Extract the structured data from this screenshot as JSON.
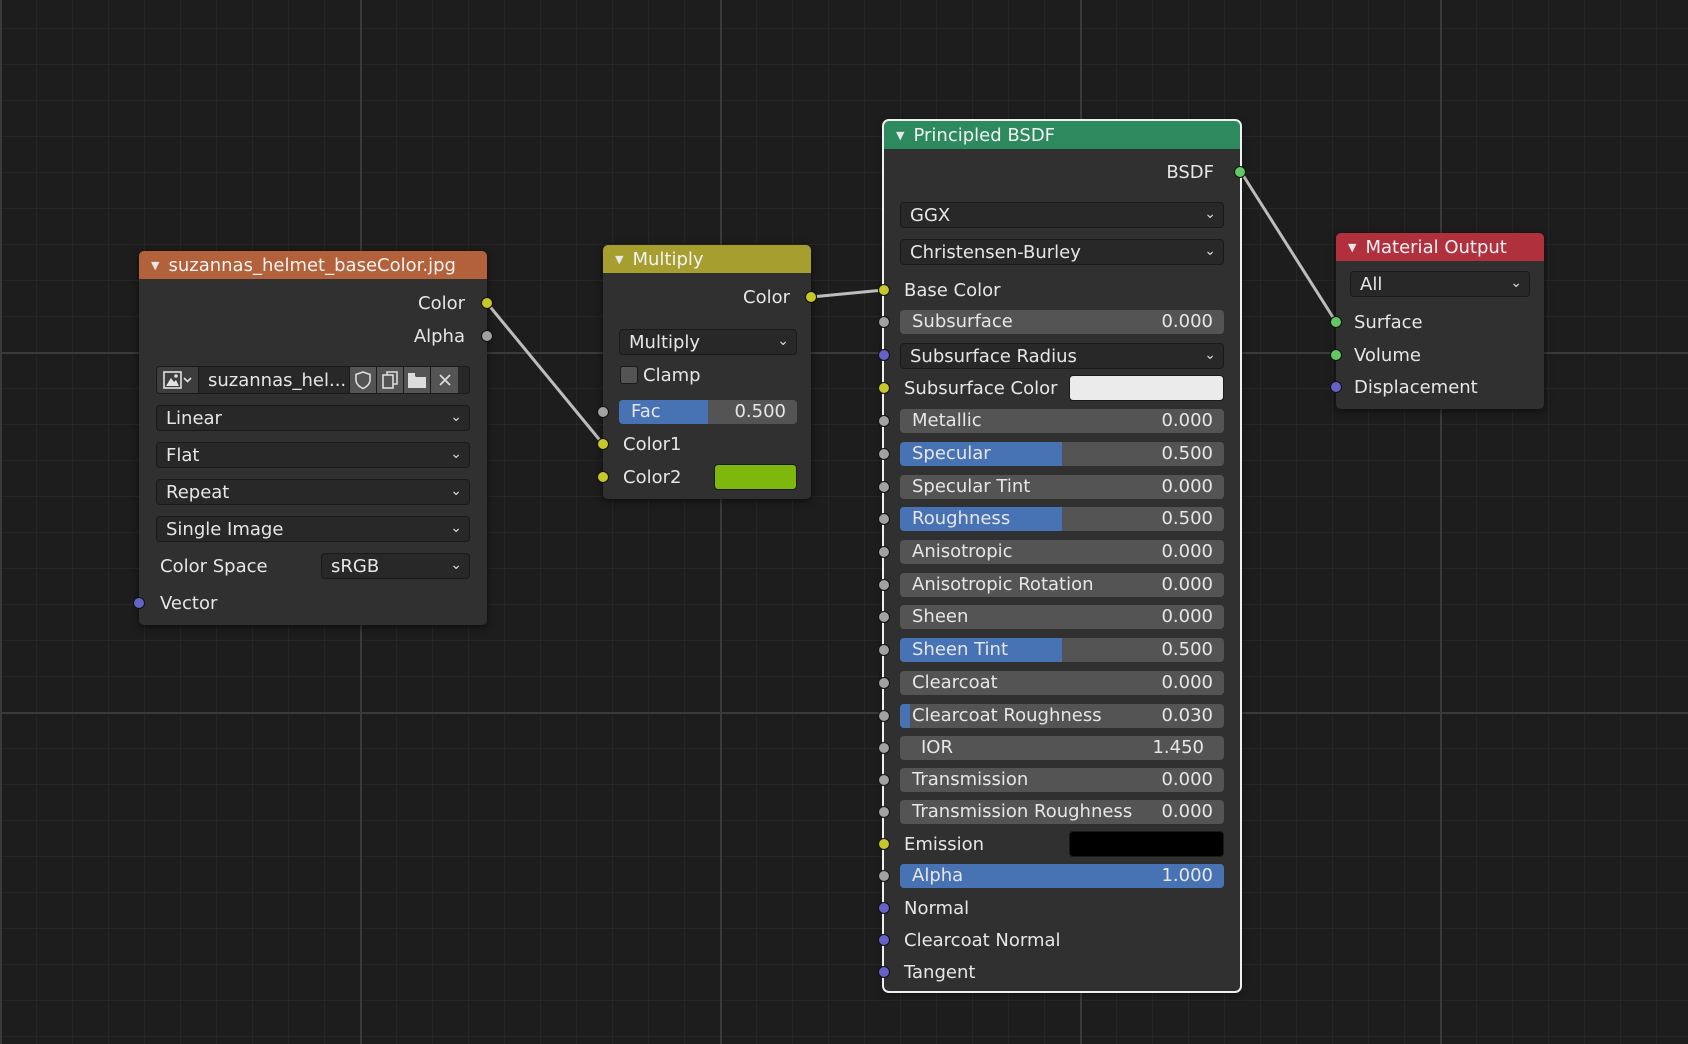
{
  "colors": {
    "image_header": "#b3613a",
    "multiply_header": "#a69e2e",
    "bsdf_header": "#2d8a5f",
    "output_header": "#b0313d",
    "color2_swatch": "#7fb80c",
    "subsurface_color_swatch": "#ebebeb",
    "emission_swatch": "#000000",
    "slider_fill": "#4772b3",
    "link": "#bdbdbd"
  },
  "image_node": {
    "title": "suzannas_helmet_baseColor.jpg",
    "outputs": [
      "Color",
      "Alpha"
    ],
    "image_name": "suzannas_hel...",
    "interpolation": "Linear",
    "projection": "Flat",
    "extension": "Repeat",
    "source": "Single Image",
    "color_space_label": "Color Space",
    "color_space": "sRGB",
    "input_vector": "Vector"
  },
  "multiply_node": {
    "title": "Multiply",
    "output": "Color",
    "blend_type": "Multiply",
    "clamp_label": "Clamp",
    "clamp": false,
    "fac_label": "Fac",
    "fac_value": "0.500",
    "fac": 0.5,
    "color1_label": "Color1",
    "color2_label": "Color2"
  },
  "bsdf_node": {
    "title": "Principled BSDF",
    "output": "BSDF",
    "distribution": "GGX",
    "subsurface_method": "Christensen-Burley",
    "base_color_label": "Base Color",
    "subsurface": {
      "label": "Subsurface",
      "value": "0.000",
      "fac": 0
    },
    "subsurface_radius": "Subsurface Radius",
    "subsurface_color_label": "Subsurface Color",
    "metallic": {
      "label": "Metallic",
      "value": "0.000",
      "fac": 0
    },
    "specular": {
      "label": "Specular",
      "value": "0.500",
      "fac": 0.5
    },
    "specular_tint": {
      "label": "Specular Tint",
      "value": "0.000",
      "fac": 0
    },
    "roughness": {
      "label": "Roughness",
      "value": "0.500",
      "fac": 0.5
    },
    "anisotropic": {
      "label": "Anisotropic",
      "value": "0.000",
      "fac": 0
    },
    "anisotropic_rotation": {
      "label": "Anisotropic Rotation",
      "value": "0.000",
      "fac": 0
    },
    "sheen": {
      "label": "Sheen",
      "value": "0.000",
      "fac": 0
    },
    "sheen_tint": {
      "label": "Sheen Tint",
      "value": "0.500",
      "fac": 0.5
    },
    "clearcoat": {
      "label": "Clearcoat",
      "value": "0.000",
      "fac": 0
    },
    "clearcoat_roughness": {
      "label": "Clearcoat Roughness",
      "value": "0.030",
      "fac": 0.03
    },
    "ior": {
      "label": "IOR",
      "value": "1.450"
    },
    "transmission": {
      "label": "Transmission",
      "value": "0.000",
      "fac": 0
    },
    "transmission_roughness": {
      "label": "Transmission Roughness",
      "value": "0.000",
      "fac": 0
    },
    "emission_label": "Emission",
    "alpha": {
      "label": "Alpha",
      "value": "1.000",
      "fac": 1
    },
    "normal_label": "Normal",
    "clearcoat_normal_label": "Clearcoat Normal",
    "tangent_label": "Tangent"
  },
  "output_node": {
    "title": "Material Output",
    "target": "All",
    "inputs": [
      "Surface",
      "Volume",
      "Displacement"
    ]
  }
}
